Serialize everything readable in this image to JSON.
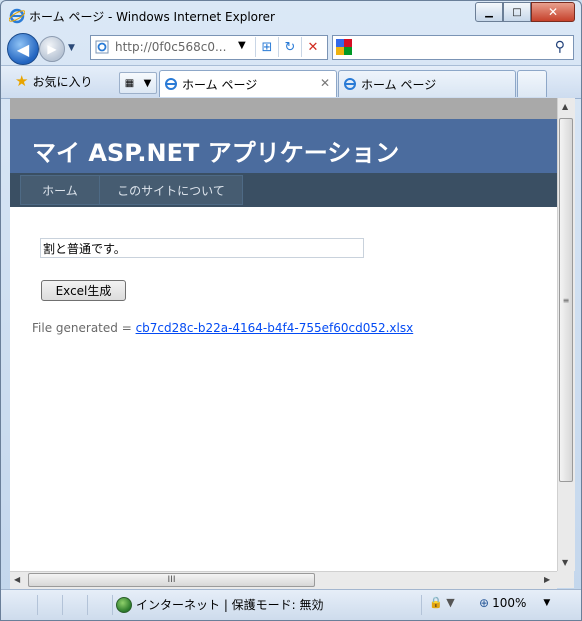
{
  "window": {
    "title": "ホーム ページ - Windows Internet Explorer",
    "minimize_glyph": "▁",
    "maximize_glyph": "□",
    "close_glyph": "✕"
  },
  "nav": {
    "back_glyph": "◀",
    "forward_glyph": "▶",
    "address": "http://0f0c568c0...",
    "dropdown_glyph": "▼",
    "compat_glyph": "⊞",
    "refresh_glyph": "↻",
    "stop_glyph": "✕",
    "search_value": "",
    "search_glyph": "⚲"
  },
  "tabs": {
    "favorites_label": "お気に入り",
    "items": [
      {
        "label": "ホーム ページ",
        "active": true,
        "close_glyph": "✕"
      },
      {
        "label": "ホーム ページ",
        "active": false
      }
    ]
  },
  "page": {
    "app_title": "マイ ASP.NET アプリケーション",
    "menu": [
      {
        "label": "ホーム"
      },
      {
        "label": "このサイトについて"
      }
    ],
    "textbox_value": "割と普通です。",
    "excel_button_label": "Excel生成",
    "file_generated_label": "File generated = ",
    "file_link_text": "cb7cd28c-b22a-4164-b4f4-755ef60cd052.xlsx"
  },
  "scrollbars": {
    "v_grip": "≡",
    "h_grip": "III",
    "up": "▲",
    "down": "▼",
    "left": "◀",
    "right": "▶"
  },
  "status": {
    "zone_text": "インターネット | 保護モード: 無効",
    "zoom_text": "100%",
    "zoom_glyph": "⊕",
    "dropdown_glyph": "▼",
    "security_glyph": "🔒"
  },
  "colors": {
    "header_bg": "#4b6c9e",
    "menu_bg": "#3a4f63",
    "link": "#034af3"
  }
}
